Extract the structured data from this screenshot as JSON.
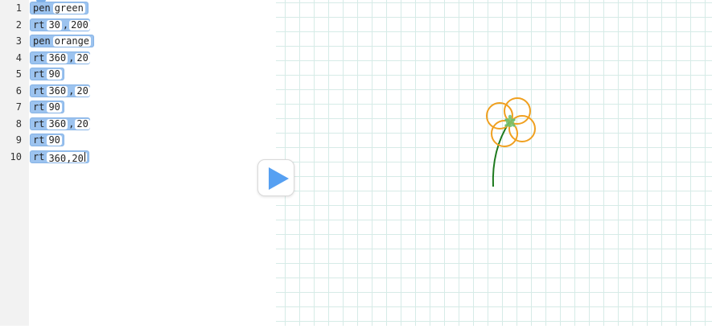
{
  "line_numbers": [
    "1",
    "2",
    "3",
    "4",
    "5",
    "6",
    "7",
    "8",
    "9",
    "10"
  ],
  "code": [
    {
      "cmd": "pen",
      "args": [
        "green"
      ]
    },
    {
      "cmd": "rt",
      "args": [
        "30",
        "200"
      ]
    },
    {
      "cmd": "pen",
      "args": [
        "orange"
      ]
    },
    {
      "cmd": "rt",
      "args": [
        "360",
        "20"
      ]
    },
    {
      "cmd": "rt",
      "args": [
        "90"
      ]
    },
    {
      "cmd": "rt",
      "args": [
        "360",
        "20"
      ]
    },
    {
      "cmd": "rt",
      "args": [
        "90"
      ]
    },
    {
      "cmd": "rt",
      "args": [
        "360",
        "20"
      ]
    },
    {
      "cmd": "rt",
      "args": [
        "90"
      ]
    },
    {
      "cmd": "rt",
      "args": [
        "360,20"
      ]
    }
  ],
  "colors": {
    "block_fill": "#9cc3ef",
    "run_triangle": "#56a0f2",
    "stem": "#1e7a1e",
    "petals": "#f0a020",
    "grid": "#d6ebe7"
  },
  "icons": {
    "run": "play-triangle-icon"
  }
}
